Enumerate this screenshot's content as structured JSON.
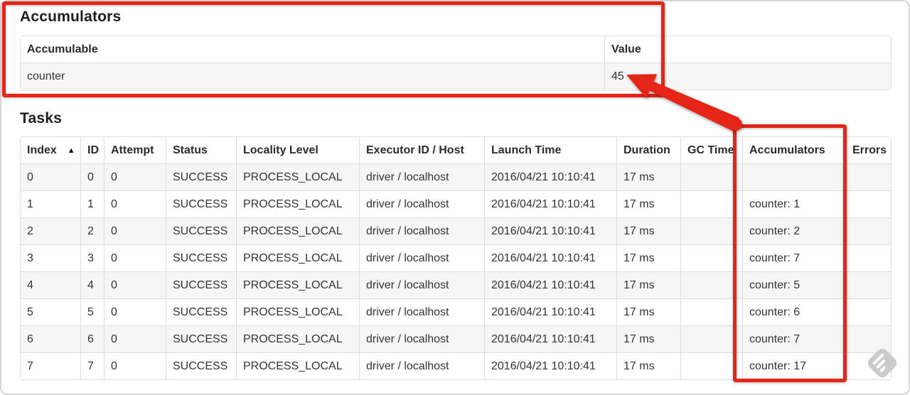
{
  "colors": {
    "annotation_red": "#e52517",
    "table_border": "#dddddd",
    "row_stripe": "#f6f6f6",
    "text": "#333333",
    "watermark_gray": "#c9c9c9"
  },
  "icons": {
    "sort_ascending": "▲"
  },
  "accumulators_section": {
    "title": "Accumulators",
    "table": {
      "headers": [
        "Accumulable",
        "Value"
      ],
      "rows": [
        [
          "counter",
          "45"
        ]
      ]
    }
  },
  "tasks_section": {
    "title": "Tasks",
    "sorted_column": "Index",
    "table": {
      "headers": [
        "Index",
        "ID",
        "Attempt",
        "Status",
        "Locality Level",
        "Executor ID / Host",
        "Launch Time",
        "Duration",
        "GC Time",
        "Accumulators",
        "Errors"
      ],
      "rows": [
        [
          "0",
          "0",
          "0",
          "SUCCESS",
          "PROCESS_LOCAL",
          "driver / localhost",
          "2016/04/21 10:10:41",
          "17 ms",
          "",
          "",
          ""
        ],
        [
          "1",
          "1",
          "0",
          "SUCCESS",
          "PROCESS_LOCAL",
          "driver / localhost",
          "2016/04/21 10:10:41",
          "17 ms",
          "",
          "counter: 1",
          ""
        ],
        [
          "2",
          "2",
          "0",
          "SUCCESS",
          "PROCESS_LOCAL",
          "driver / localhost",
          "2016/04/21 10:10:41",
          "17 ms",
          "",
          "counter: 2",
          ""
        ],
        [
          "3",
          "3",
          "0",
          "SUCCESS",
          "PROCESS_LOCAL",
          "driver / localhost",
          "2016/04/21 10:10:41",
          "17 ms",
          "",
          "counter: 7",
          ""
        ],
        [
          "4",
          "4",
          "0",
          "SUCCESS",
          "PROCESS_LOCAL",
          "driver / localhost",
          "2016/04/21 10:10:41",
          "17 ms",
          "",
          "counter: 5",
          ""
        ],
        [
          "5",
          "5",
          "0",
          "SUCCESS",
          "PROCESS_LOCAL",
          "driver / localhost",
          "2016/04/21 10:10:41",
          "17 ms",
          "",
          "counter: 6",
          ""
        ],
        [
          "6",
          "6",
          "0",
          "SUCCESS",
          "PROCESS_LOCAL",
          "driver / localhost",
          "2016/04/21 10:10:41",
          "17 ms",
          "",
          "counter: 7",
          ""
        ],
        [
          "7",
          "7",
          "0",
          "SUCCESS",
          "PROCESS_LOCAL",
          "driver / localhost",
          "2016/04/21 10:10:41",
          "17 ms",
          "",
          "counter: 17",
          ""
        ]
      ]
    }
  }
}
